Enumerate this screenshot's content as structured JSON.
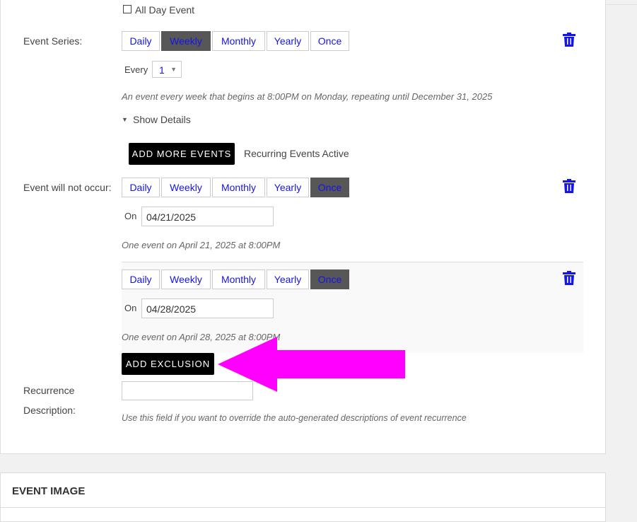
{
  "all_day": {
    "label": "All Day Event",
    "checked": false
  },
  "event_series": {
    "label": "Event Series:",
    "frequencies": [
      "Daily",
      "Weekly",
      "Monthly",
      "Yearly",
      "Once"
    ],
    "selected": "Weekly",
    "every_label": "Every",
    "every_value": "1",
    "summary": "An event every week that begins at 8:00PM on Monday, repeating until December 31, 2025",
    "show_details": "Show Details"
  },
  "add_more_events": {
    "label": "ADD MORE EVENTS",
    "status": "Recurring Events Active"
  },
  "exclusions": {
    "label": "Event will not occur:",
    "items": [
      {
        "frequencies": [
          "Daily",
          "Weekly",
          "Monthly",
          "Yearly",
          "Once"
        ],
        "selected": "Once",
        "on_label": "On",
        "date": "04/21/2025",
        "summary": "One event on April 21, 2025 at 8:00PM"
      },
      {
        "frequencies": [
          "Daily",
          "Weekly",
          "Monthly",
          "Yearly",
          "Once"
        ],
        "selected": "Once",
        "on_label": "On",
        "date": "04/28/2025",
        "summary": "One event on April 28, 2025 at 8:00PM"
      }
    ],
    "add_label": "ADD EXCLUSION"
  },
  "recurrence_description": {
    "label_line1": "Recurrence",
    "label_line2": "Description:",
    "value": "",
    "help": "Use this field if you want to override the auto-generated descriptions of event recurrence"
  },
  "event_image": {
    "title": "EVENT IMAGE"
  },
  "colors": {
    "link_blue": "#1515e6",
    "active_gray": "#575757",
    "trash_blue": "#1515e6",
    "arrow_magenta": "#ff00ff"
  },
  "icons": [
    "trash-icon",
    "caret-down-icon",
    "arrow-left-icon"
  ]
}
